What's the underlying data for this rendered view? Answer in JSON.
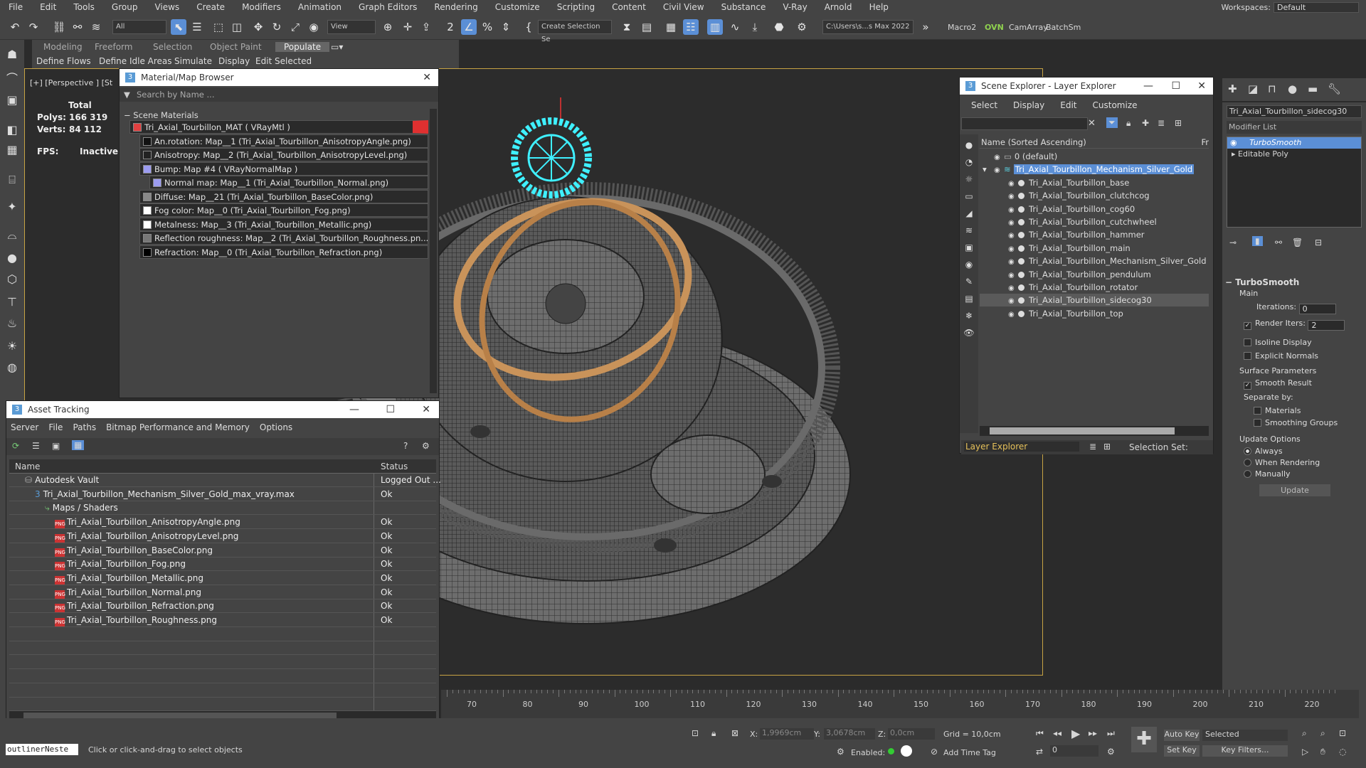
{
  "menu": [
    "File",
    "Edit",
    "Tools",
    "Group",
    "Views",
    "Create",
    "Modifiers",
    "Animation",
    "Graph Editors",
    "Rendering",
    "Customize",
    "Scripting",
    "Content",
    "Civil View",
    "Substance",
    "V-Ray",
    "Arnold",
    "Help"
  ],
  "workspaces": {
    "label": "Workspaces:",
    "value": "Default"
  },
  "toolbar": {
    "filter": "All",
    "view": "View",
    "selection_set": "Create Selection Se",
    "path": "C:\\Users\\s...s Max 2022",
    "macro": "Macro2",
    "ovn": "OVN",
    "camarray": "CamArray",
    "batchsm": "BatchSm"
  },
  "ribbon": {
    "tabs": [
      "Modeling",
      "Freeform",
      "Selection",
      "Object Paint",
      "Populate"
    ],
    "sub": [
      "Define Flows",
      "Define Idle Areas",
      "Simulate",
      "Display",
      "Edit Selected"
    ]
  },
  "viewport": {
    "label": "[+] [Perspective ] [St",
    "stats": {
      "total": "Total",
      "polys_label": "Polys:",
      "polys": "166 319",
      "verts_label": "Verts:",
      "verts": "84 112",
      "fps_label": "FPS:",
      "fps": "Inactive"
    }
  },
  "material_browser": {
    "title": "Material/Map Browser",
    "search": "Search by Name ...",
    "group": "Scene Materials",
    "rows": [
      {
        "text": "Tri_Axial_Tourbillon_MAT  ( VRayMtl )",
        "indent": 0,
        "color": "#e04040"
      },
      {
        "text": "An.rotation: Map__1 (Tri_Axial_Tourbillon_AnisotropyAngle.png)",
        "indent": 1,
        "color": "#111111"
      },
      {
        "text": "Anisotropy: Map__2 (Tri_Axial_Tourbillon_AnisotropyLevel.png)",
        "indent": 1,
        "color": "#222222"
      },
      {
        "text": "Bump: Map #4  ( VRayNormalMap )",
        "indent": 1,
        "color": "#9c9cf0"
      },
      {
        "text": "Normal map: Map__1 (Tri_Axial_Tourbillon_Normal.png)",
        "indent": 2,
        "color": "#9c9cf0"
      },
      {
        "text": "Diffuse: Map__21 (Tri_Axial_Tourbillon_BaseColor.png)",
        "indent": 1,
        "color": "#888888"
      },
      {
        "text": "Fog color: Map__0 (Tri_Axial_Tourbillon_Fog.png)",
        "indent": 1,
        "color": "#ffffff"
      },
      {
        "text": "Metalness: Map__3 (Tri_Axial_Tourbillon_Metallic.png)",
        "indent": 1,
        "color": "#ffffff"
      },
      {
        "text": "Reflection roughness: Map__2 (Tri_Axial_Tourbillon_Roughness.pn...",
        "indent": 1,
        "color": "#777777"
      },
      {
        "text": "Refraction: Map__0 (Tri_Axial_Tourbillon_Refraction.png)",
        "indent": 1,
        "color": "#000000"
      }
    ]
  },
  "asset_tracking": {
    "title": "Asset Tracking",
    "menu": [
      "Server",
      "File",
      "Paths",
      "Bitmap Performance and Memory",
      "Options"
    ],
    "col_name": "Name",
    "col_status": "Status",
    "rows": [
      {
        "name": "Autodesk Vault",
        "status": "Logged Out ...",
        "indent": 1,
        "icon": "vault"
      },
      {
        "name": "Tri_Axial_Tourbillon_Mechanism_Silver_Gold_max_vray.max",
        "status": "Ok",
        "indent": 2,
        "icon": "max"
      },
      {
        "name": "Maps / Shaders",
        "status": "",
        "indent": 3,
        "icon": "maps"
      },
      {
        "name": "Tri_Axial_Tourbillon_AnisotropyAngle.png",
        "status": "Ok",
        "indent": 4,
        "icon": "png"
      },
      {
        "name": "Tri_Axial_Tourbillon_AnisotropyLevel.png",
        "status": "Ok",
        "indent": 4,
        "icon": "png"
      },
      {
        "name": "Tri_Axial_Tourbillon_BaseColor.png",
        "status": "Ok",
        "indent": 4,
        "icon": "png"
      },
      {
        "name": "Tri_Axial_Tourbillon_Fog.png",
        "status": "Ok",
        "indent": 4,
        "icon": "png"
      },
      {
        "name": "Tri_Axial_Tourbillon_Metallic.png",
        "status": "Ok",
        "indent": 4,
        "icon": "png"
      },
      {
        "name": "Tri_Axial_Tourbillon_Normal.png",
        "status": "Ok",
        "indent": 4,
        "icon": "png"
      },
      {
        "name": "Tri_Axial_Tourbillon_Refraction.png",
        "status": "Ok",
        "indent": 4,
        "icon": "png"
      },
      {
        "name": "Tri_Axial_Tourbillon_Roughness.png",
        "status": "Ok",
        "indent": 4,
        "icon": "png"
      }
    ]
  },
  "scene_explorer": {
    "title": "Scene Explorer - Layer Explorer",
    "menu": [
      "Select",
      "Display",
      "Edit",
      "Customize"
    ],
    "header": "Name (Sorted Ascending)",
    "header_right": "Fr",
    "rows": [
      {
        "text": "0 (default)",
        "indent": 0,
        "sel": false
      },
      {
        "text": "Tri_Axial_Tourbillon_Mechanism_Silver_Gold",
        "indent": 0,
        "sel": false,
        "layer": true
      },
      {
        "text": "Tri_Axial_Tourbillon_base",
        "indent": 1,
        "sel": false
      },
      {
        "text": "Tri_Axial_Tourbillon_clutchcog",
        "indent": 1,
        "sel": false
      },
      {
        "text": "Tri_Axial_Tourbillon_cog60",
        "indent": 1,
        "sel": false
      },
      {
        "text": "Tri_Axial_Tourbillon_cutchwheel",
        "indent": 1,
        "sel": false
      },
      {
        "text": "Tri_Axial_Tourbillon_hammer",
        "indent": 1,
        "sel": false
      },
      {
        "text": "Tri_Axial_Tourbillon_main",
        "indent": 1,
        "sel": false
      },
      {
        "text": "Tri_Axial_Tourbillon_Mechanism_Silver_Gold",
        "indent": 1,
        "sel": false
      },
      {
        "text": "Tri_Axial_Tourbillon_pendulum",
        "indent": 1,
        "sel": false
      },
      {
        "text": "Tri_Axial_Tourbillon_rotator",
        "indent": 1,
        "sel": false
      },
      {
        "text": "Tri_Axial_Tourbillon_sidecog30",
        "indent": 1,
        "sel": true
      },
      {
        "text": "Tri_Axial_Tourbillon_top",
        "indent": 1,
        "sel": false
      }
    ],
    "footer_left": "Layer Explorer",
    "footer_right": "Selection Set:"
  },
  "command_panel": {
    "object_name": "Tri_Axial_Tourbillon_sidecog30",
    "modifier_list": "Modifier List",
    "stack": [
      "TurboSmooth",
      "Editable Poly"
    ],
    "rollout": "TurboSmooth",
    "main": "Main",
    "iterations_label": "Iterations:",
    "iterations": "0",
    "render_iters_label": "Render Iters:",
    "render_iters": "2",
    "isoline": "Isoline Display",
    "explicit": "Explicit Normals",
    "surface": "Surface Parameters",
    "smooth": "Smooth Result",
    "separate": "Separate by:",
    "materials": "Materials",
    "smoothing": "Smoothing Groups",
    "update_opts": "Update Options",
    "always": "Always",
    "when_rendering": "When Rendering",
    "manually": "Manually",
    "update_btn": "Update"
  },
  "timeline": {
    "ticks": [
      "70",
      "80",
      "90",
      "100",
      "110",
      "120",
      "130",
      "140",
      "150",
      "160",
      "170",
      "180",
      "190",
      "200",
      "210",
      "220"
    ]
  },
  "status": {
    "script": "outlinerNeste",
    "prompt": "Click or click-and-drag to select objects",
    "x_label": "X:",
    "x": "1,9969cm",
    "y_label": "Y:",
    "y": "3,0678cm",
    "z_label": "Z:",
    "z": "0,0cm",
    "grid": "Grid = 10,0cm",
    "enabled": "Enabled:",
    "add_time_tag": "Add Time Tag",
    "auto_key": "Auto Key",
    "selected": "Selected",
    "set_key": "Set Key",
    "key_filters": "Key Filters...",
    "frame": "0"
  }
}
